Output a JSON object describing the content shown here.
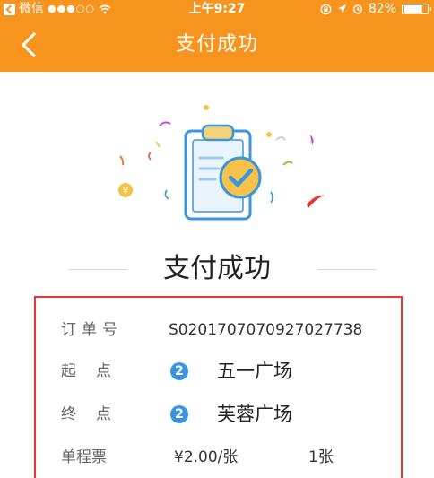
{
  "status_bar": {
    "carrier": "微信",
    "signal": "●●●○○",
    "time": "上午9:27",
    "battery_percent": "82%",
    "battery_level": 0.82
  },
  "nav": {
    "title": "支付成功",
    "back_icon": "chevron-left-icon"
  },
  "illustration": {
    "icon": "clipboard-check-icon",
    "coin_symbol": "¥",
    "colors": {
      "clipboard": "#3a95dd",
      "check_circle": "#f5c24a",
      "clip": "#f5d27a"
    }
  },
  "success": {
    "title": "支付成功"
  },
  "order": {
    "order_no_label": "订单号",
    "order_no_value": "S020170707092702773 8",
    "start_label": "起点",
    "start_line": "2",
    "start_station": "五一广场",
    "end_label": "终点",
    "end_line": "2",
    "end_station": "芙蓉广场",
    "ticket_label": "单程票",
    "ticket_price": "¥2.00/张",
    "ticket_count": "1张"
  },
  "colors": {
    "header_bg": "#f7941d",
    "highlight_border": "#e23a3a",
    "line_badge": "#3a95dd"
  }
}
